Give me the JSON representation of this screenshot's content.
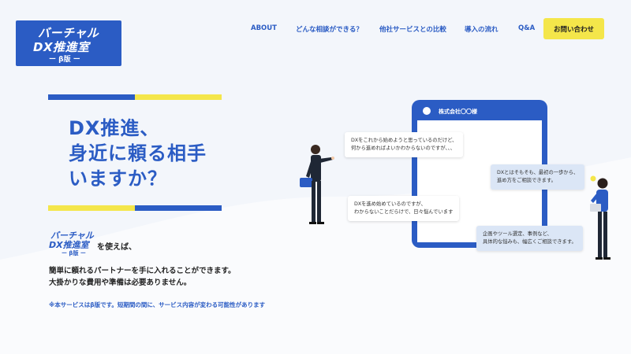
{
  "logo": {
    "line1": "バーチャル",
    "line2": "DX推進室",
    "line3": "ー β版 ー"
  },
  "nav": {
    "items": [
      {
        "label": "ABOUT"
      },
      {
        "label": "どんな相談ができる？"
      },
      {
        "label": "他社サービスとの比較"
      },
      {
        "label": "導入の流れ"
      },
      {
        "label": "Q&A"
      }
    ],
    "contact_label": "お問い合わせ"
  },
  "hero": {
    "title_line1": "DX推進、",
    "title_line2": "身近に頼る相手",
    "title_line3": "いますか？",
    "mini_logo": {
      "line1": "バーチャル",
      "line2": "DX推進室",
      "line3": "ー β版 ー"
    },
    "uses": "を使えば、",
    "desc_line1": "簡単に頼れるパートナーを手に入れることができます。",
    "desc_line2": "大掛かりな費用や準備は必要ありません。",
    "note": "※本サービスはβ版です。短期間の間に、サービス内容が変わる可能性があります"
  },
  "phone": {
    "title": "株式会社〇〇様"
  },
  "bubbles": {
    "b1_line1": "DXをこれから始めようと思っているのだけど、",
    "b1_line2": "何から進めればよいかわからないのですが、、、",
    "b2_line1": "DXとはそもそも、最初の一歩から、",
    "b2_line2": "進め方をご相談できます。",
    "b3_line1": "DXを進め始めているのですが、",
    "b3_line2": "わからないことだらけで、日々悩んでいます",
    "b4_line1": "企画やツール選定、事例など、",
    "b4_line2": "具体的な悩みも、幅広くご相談できます。"
  },
  "colors": {
    "brand_blue": "#2b5cc4",
    "accent_yellow": "#f4e64a",
    "background": "#f3f6fb"
  }
}
